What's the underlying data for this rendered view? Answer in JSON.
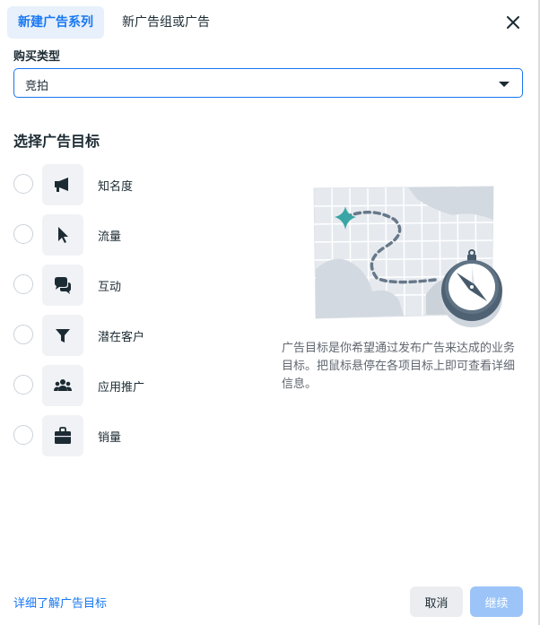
{
  "tabs": [
    {
      "label": "新建广告系列",
      "active": true
    },
    {
      "label": "新广告组或广告",
      "active": false
    }
  ],
  "buy_type": {
    "label": "购买类型",
    "value": "竞拍"
  },
  "objective_section": {
    "title": "选择广告目标",
    "options": [
      {
        "label": "知名度",
        "icon": "megaphone-icon"
      },
      {
        "label": "流量",
        "icon": "cursor-icon"
      },
      {
        "label": "互动",
        "icon": "chat-bubbles-icon"
      },
      {
        "label": "潜在客户",
        "icon": "funnel-icon"
      },
      {
        "label": "应用推广",
        "icon": "people-icon"
      },
      {
        "label": "销量",
        "icon": "shopping-bag-icon"
      }
    ]
  },
  "description": "广告目标是你希望通过发布广告来达成的业务目标。把鼠标悬停在各项目标上即可查看详细信息。",
  "footer": {
    "learn_more": "详细了解广告目标",
    "cancel": "取消",
    "continue": "继续"
  },
  "colors": {
    "accent": "#1877f2",
    "tab_active_bg": "#e7f0fb",
    "continue_disabled": "#9cc4f8",
    "star": "#3aa5a5"
  }
}
